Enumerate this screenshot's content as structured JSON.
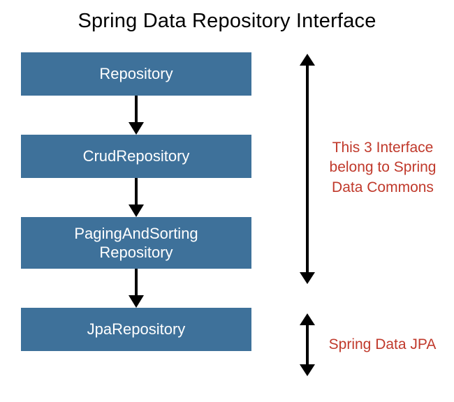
{
  "title": "Spring Data Repository Interface",
  "boxes": {
    "b1": "Repository",
    "b2": "CrudRepository",
    "b3": "PagingAndSorting\nRepository",
    "b4": "JpaRepository"
  },
  "annotations": {
    "commons": "This 3 Interface belong to Spring Data Commons",
    "jpa": "Spring Data JPA"
  },
  "colors": {
    "box_bg": "#3e719a",
    "box_fg": "#ffffff",
    "annot_fg": "#c0392b",
    "arrow": "#000000"
  }
}
